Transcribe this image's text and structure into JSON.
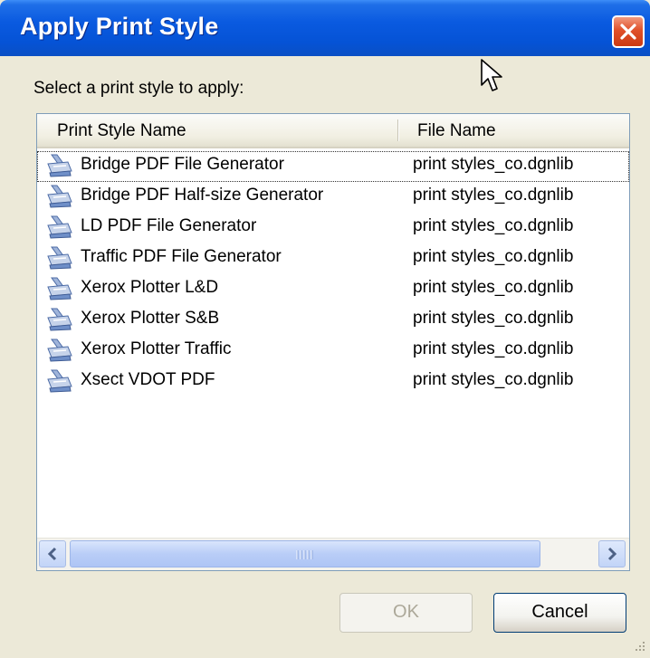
{
  "window": {
    "title": "Apply Print Style"
  },
  "prompt": "Select a print style to apply:",
  "list": {
    "columns": [
      "Print Style Name",
      "File Name"
    ],
    "rows": [
      {
        "name": "Bridge PDF File Generator",
        "file": "print styles_co.dgnlib"
      },
      {
        "name": "Bridge PDF Half-size Generator",
        "file": "print styles_co.dgnlib"
      },
      {
        "name": "LD PDF File Generator",
        "file": "print styles_co.dgnlib"
      },
      {
        "name": "Traffic PDF File Generator",
        "file": "print styles_co.dgnlib"
      },
      {
        "name": "Xerox Plotter L&D",
        "file": "print styles_co.dgnlib"
      },
      {
        "name": "Xerox Plotter S&B",
        "file": "print styles_co.dgnlib"
      },
      {
        "name": "Xerox Plotter Traffic",
        "file": "print styles_co.dgnlib"
      },
      {
        "name": "Xsect VDOT PDF",
        "file": "print styles_co.dgnlib"
      }
    ],
    "row_icon": "print-style-icon"
  },
  "buttons": {
    "ok": "OK",
    "cancel": "Cancel"
  },
  "colors": {
    "titlebar": "#0553d6",
    "close": "#e0502a",
    "dialog_bg": "#ece9d8"
  }
}
